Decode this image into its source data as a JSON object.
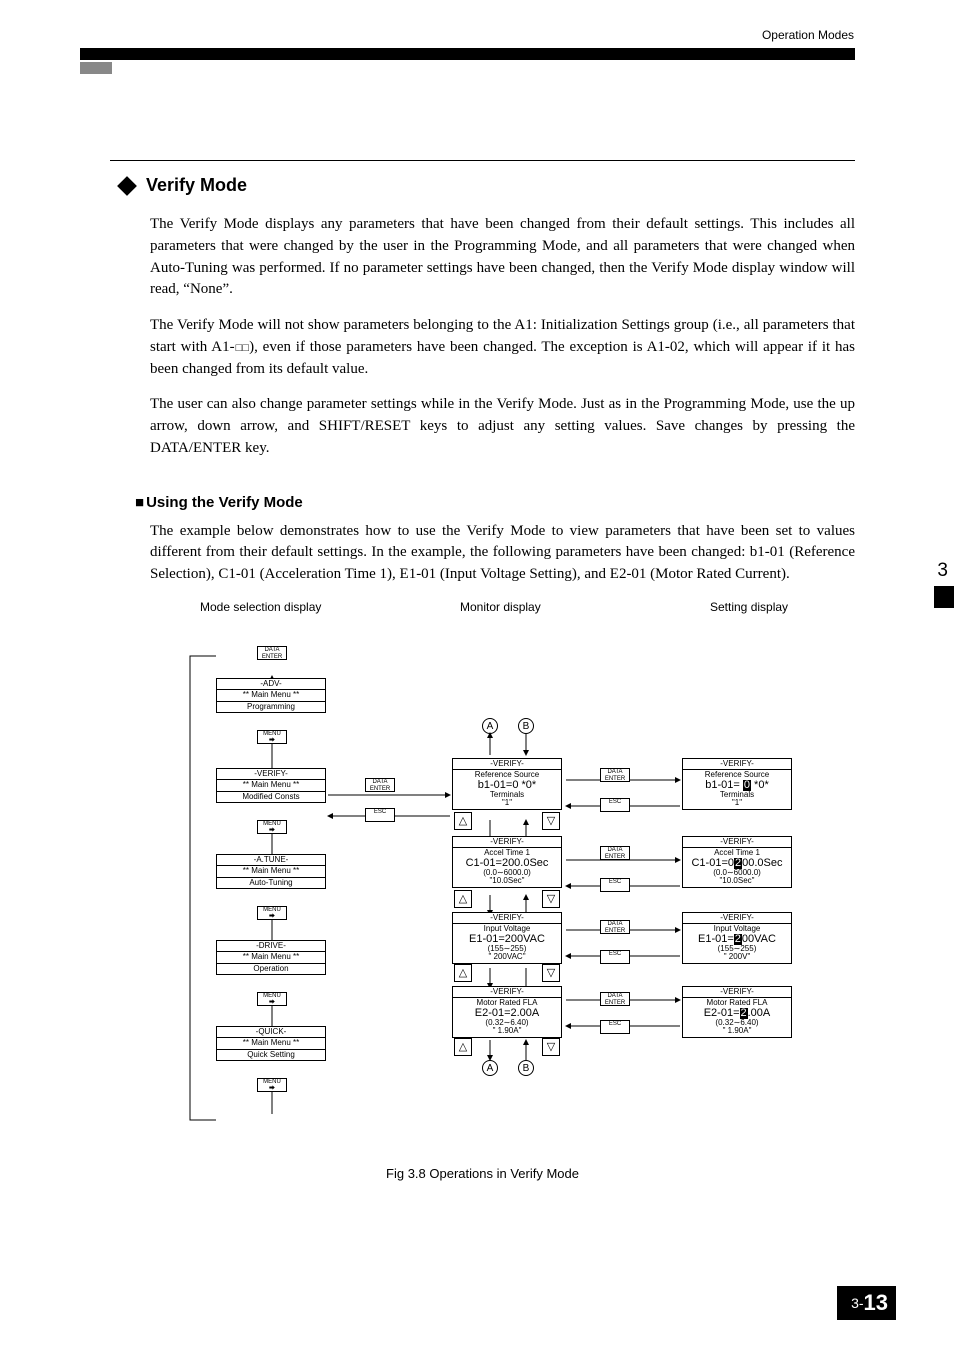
{
  "page": {
    "header_right": "Operation Modes",
    "section_number": "3",
    "page_prefix": "3-",
    "page_number": "13"
  },
  "h1": "Verify Mode",
  "p1": "The Verify Mode displays any parameters that have been changed from their default settings. This includes all parameters that were changed by the user in the Programming Mode, and all parameters that were changed when Auto-Tuning was performed. If no parameter settings have been changed, then the Verify Mode display window will read, “None”.",
  "p2a": "The Verify Mode will not show parameters belonging to the A1: Initialization Settings group (i.e., all parameters that start with A1-",
  "p2b": "), even if those parameters have been changed. The exception is A1-02, which will appear if it has been changed from its default value.",
  "p3": "The user can also change parameter settings while in the Verify Mode. Just as in the Programming Mode, use the up arrow, down arrow, and SHIFT/RESET keys to adjust any setting values. Save changes by pressing the DATA/ENTER key.",
  "h2": "Using the Verify Mode",
  "p4": "The example below demonstrates how to use the Verify Mode to view parameters that have been set to values different from their default settings. In the example, the following parameters have been changed: b1-01 (Reference Selection), C1-01 (Acceleration Time 1), E1-01 (Input Voltage Setting), and E2-01 (Motor Rated Current).",
  "diagram": {
    "col1_label": "Mode selection display",
    "col2_label": "Monitor display",
    "col3_label": "Setting display",
    "main_menu": "** Main Menu **",
    "menus": {
      "adv": {
        "tag": "-ADV-",
        "item": "Programming"
      },
      "verify": {
        "tag": "-VERIFY-",
        "item": "Modified Consts"
      },
      "atune": {
        "tag": "-A.TUNE-",
        "item": "Auto-Tuning"
      },
      "drive": {
        "tag": "-DRIVE-",
        "item": "Operation"
      },
      "quick": {
        "tag": "-QUICK-",
        "item": "Quick Setting"
      }
    },
    "verify_tag": "-VERIFY-",
    "params": {
      "b1": {
        "title": "Reference Source",
        "line": "b1-01=0 *0*",
        "sub1": "Terminals",
        "sub2": "\"1\"",
        "edit": "b1-01= ",
        "edit_hl": "0",
        "edit_sfx": " *0*"
      },
      "c1": {
        "title": "Accel Time 1",
        "line": "C1-01=200.0Sec",
        "sub1": "(0.0∼6000.0)",
        "sub2": "\"10.0Sec\"",
        "edit": "C1-01=0",
        "edit_hl": "2",
        "edit_sfx": "00.0Sec"
      },
      "e1": {
        "title": "Input Voltage",
        "line": "E1-01=200VAC",
        "sub1": "(155∼255)",
        "sub2": "\" 200VAC\"",
        "edit": "E1-01=",
        "edit_hl": "2",
        "edit_sfx": "00VAC",
        "sub2e": "\" 200V\""
      },
      "e2": {
        "title": "Motor Rated FLA",
        "line": "E2-01=2.00A",
        "sub1": "(0.32∼6.40)",
        "sub2": "\" 1.90A\"",
        "edit": "E2-01=",
        "edit_hl": "2",
        "edit_sfx": ".00A"
      }
    },
    "keys": {
      "data_enter": "DATA\nENTER",
      "menu": "MENU",
      "esc": "ESC"
    },
    "letters": {
      "A": "A",
      "B": "B"
    },
    "caption": "Fig 3.8  Operations in Verify Mode"
  }
}
